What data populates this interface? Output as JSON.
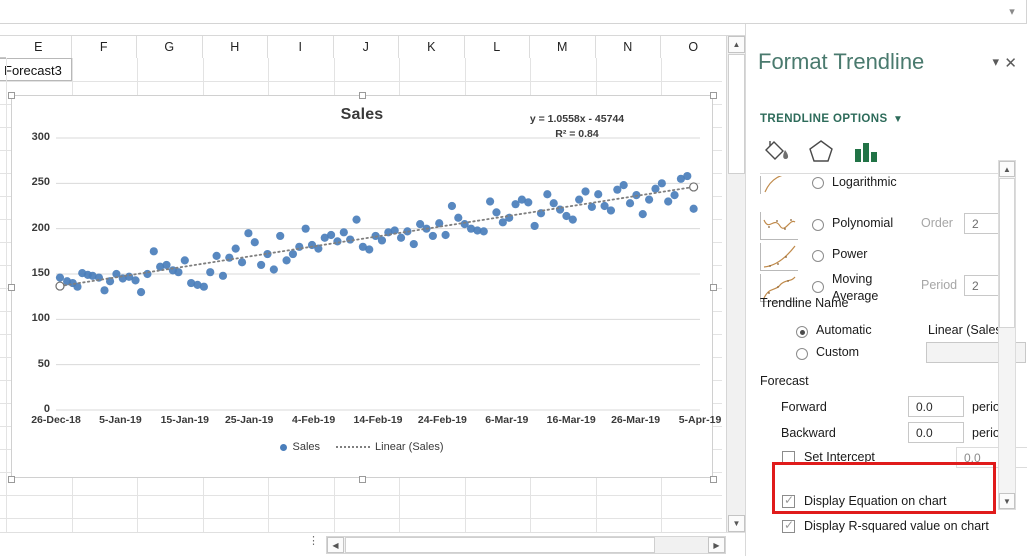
{
  "formula_bar": {
    "value": "",
    "dropdown_icon": "chevron-down-icon"
  },
  "sheet": {
    "column_headers": [
      "E",
      "F",
      "G",
      "H",
      "I",
      "J",
      "K",
      "L",
      "M",
      "N",
      "O"
    ],
    "cells": [
      {
        "ref": "E1",
        "value": "Forecast3"
      }
    ],
    "scrollbars": {
      "vertical_up": "▲",
      "vertical_down": "▼",
      "horizontal_left": "◀",
      "horizontal_right": "▶",
      "sheet_tab_handle": "⋮"
    }
  },
  "chart_data": {
    "type": "scatter",
    "title": "Sales",
    "xlabel": "",
    "ylabel": "",
    "grid": true,
    "legend_position": "bottom",
    "ylim": [
      0,
      300
    ],
    "yticks": [
      0,
      50,
      100,
      150,
      200,
      250,
      300
    ],
    "xticks": [
      "26-Dec-18",
      "5-Jan-19",
      "15-Jan-19",
      "25-Jan-19",
      "4-Feb-19",
      "14-Feb-19",
      "24-Feb-19",
      "6-Mar-19",
      "16-Mar-19",
      "26-Mar-19",
      "5-Apr-19"
    ],
    "series": [
      {
        "name": "Sales",
        "marker_color": "#4a7ebb",
        "x": [
          0.5,
          1.4,
          2.1,
          2.7,
          3.3,
          4.0,
          4.6,
          5.4,
          6.1,
          6.8,
          7.6,
          8.4,
          9.2,
          10.0,
          10.7,
          11.5,
          12.3,
          13.1,
          13.9,
          14.7,
          15.4,
          16.2,
          17.0,
          17.8,
          18.6,
          19.4,
          20.2,
          21.0,
          21.8,
          22.6,
          23.4,
          24.2,
          25.0,
          25.8,
          26.6,
          27.4,
          28.2,
          29.0,
          29.8,
          30.6,
          31.4,
          32.2,
          33.0,
          33.8,
          34.6,
          35.4,
          36.2,
          37.0,
          37.8,
          38.6,
          39.4,
          40.2,
          41.0,
          41.8,
          42.6,
          43.4,
          44.2,
          45.0,
          45.8,
          46.6,
          47.4,
          48.2,
          49.0,
          49.8,
          50.6,
          51.4,
          52.2,
          53.0,
          53.8,
          54.6,
          55.4,
          56.2,
          57.0,
          57.8,
          58.6,
          59.4,
          60.2,
          61.0,
          61.8,
          62.6,
          63.4,
          64.2,
          65.0,
          65.8,
          66.6,
          67.4,
          68.2,
          69.0,
          69.8,
          70.6,
          71.4,
          72.2,
          73.0,
          73.8,
          74.6,
          75.4,
          76.2,
          77.0,
          77.8,
          78.6,
          79.4,
          80.2
        ],
        "y": [
          146,
          142,
          140,
          136,
          151,
          149,
          148,
          146,
          132,
          142,
          150,
          145,
          147,
          143,
          130,
          150,
          175,
          158,
          160,
          154,
          152,
          165,
          140,
          138,
          136,
          152,
          170,
          148,
          168,
          178,
          163,
          195,
          185,
          160,
          172,
          155,
          192,
          165,
          172,
          180,
          200,
          182,
          178,
          190,
          193,
          186,
          196,
          188,
          210,
          180,
          177,
          192,
          187,
          196,
          198,
          190,
          197,
          183,
          205,
          200,
          192,
          206,
          193,
          225,
          212,
          205,
          200,
          198,
          197,
          230,
          218,
          207,
          212,
          227,
          232,
          229,
          203,
          217,
          238,
          228,
          221,
          214,
          210,
          232,
          241,
          224,
          238,
          225,
          220,
          243,
          248,
          228,
          237,
          216,
          232,
          244,
          250,
          230,
          237,
          255,
          258,
          222
        ]
      }
    ],
    "trendline": {
      "name": "Linear (Sales)",
      "type": "linear",
      "style": "dotted",
      "color": "#7f7f7f",
      "equation": "y = 1.0558x - 45744",
      "r_squared_label": "R² = 0.84",
      "slope": 1.0558,
      "intercept": -45744,
      "r_squared": 0.84
    },
    "legend_entries": [
      "Sales",
      "Linear (Sales)"
    ]
  },
  "pane": {
    "title": "Format Trendline",
    "dropdown_icon": "chevron-down-icon",
    "close_icon": "close-icon",
    "section": "TRENDLINE OPTIONS",
    "section_arrow": "▼",
    "tabs": [
      {
        "name": "fill-line",
        "icon": "paint-bucket-icon",
        "active": false
      },
      {
        "name": "effects",
        "icon": "pentagon-icon",
        "active": false
      },
      {
        "name": "trendline-options",
        "icon": "bar-chart-icon",
        "active": true
      }
    ],
    "trendline_types": [
      {
        "label": "Logarithmic",
        "accel": "o",
        "selected": false
      },
      {
        "label": "Polynomial",
        "accel": "d",
        "selected": false,
        "field_label": "Order",
        "field_value": "2"
      },
      {
        "label": "Power",
        "accel": "w",
        "selected": false
      },
      {
        "label": "Moving Average",
        "accel": "M",
        "selected": false,
        "field_label": "Period",
        "field_value": "2"
      }
    ],
    "trendline_name": {
      "heading": "Trendline Name",
      "automatic_label": "Automatic",
      "automatic_value": "Linear (Sales)",
      "automatic_selected": true,
      "custom_label": "Custom",
      "custom_value": "",
      "custom_selected": false
    },
    "forecast": {
      "heading": "Forecast",
      "forward_label": "Forward",
      "forward_value": "0.0",
      "forward_unit": "period",
      "backward_label": "Backward",
      "backward_value": "0.0",
      "backward_unit": "period"
    },
    "set_intercept": {
      "label": "Set Intercept",
      "value": "0.0",
      "checked": false
    },
    "display_equation": {
      "label": "Display Equation on chart",
      "checked": true
    },
    "display_rsquared": {
      "label": "Display R-squared value on chart",
      "checked": true
    },
    "highlight_color": "#e01b1b",
    "scrollbar": {
      "up": "▲",
      "down": "▼"
    }
  }
}
